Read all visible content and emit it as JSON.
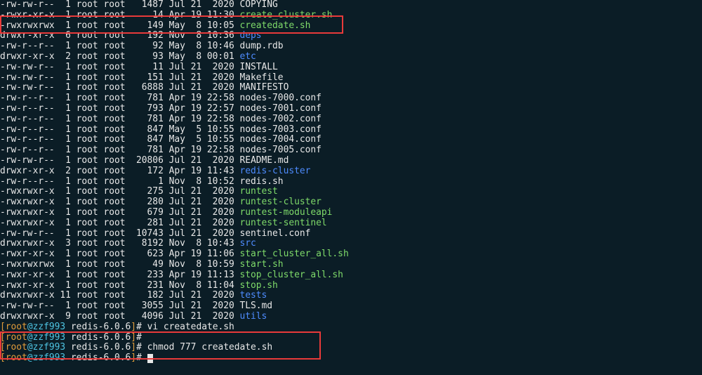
{
  "listing": [
    {
      "perm": "-rw-rw-r--",
      "links": " 1",
      "owner": "root",
      "group": "root",
      "size": "  1487",
      "date": "Jul 21  2020",
      "name": "COPYING",
      "cls": ""
    },
    {
      "perm": "-rwxr-xr-x",
      "links": " 1",
      "owner": "root",
      "group": "root",
      "size": "    14",
      "date": "Apr 19 11:30",
      "name": "create_cluster.sh",
      "cls": "green"
    },
    {
      "perm": "-rwxrwxrwx",
      "links": " 1",
      "owner": "root",
      "group": "root",
      "size": "   149",
      "date": "May  8 10:05",
      "name": "createdate.sh",
      "cls": "green"
    },
    {
      "perm": "drwxr-xr-x",
      "links": " 6",
      "owner": "root",
      "group": "root",
      "size": "   192",
      "date": "Nov  8 10:36",
      "name": "deps",
      "cls": "blue"
    },
    {
      "perm": "-rw-r--r--",
      "links": " 1",
      "owner": "root",
      "group": "root",
      "size": "    92",
      "date": "May  8 10:46",
      "name": "dump.rdb",
      "cls": ""
    },
    {
      "perm": "drwxr-xr-x",
      "links": " 2",
      "owner": "root",
      "group": "root",
      "size": "    93",
      "date": "May  8 00:01",
      "name": "etc",
      "cls": "blue"
    },
    {
      "perm": "-rw-rw-r--",
      "links": " 1",
      "owner": "root",
      "group": "root",
      "size": "    11",
      "date": "Jul 21  2020",
      "name": "INSTALL",
      "cls": ""
    },
    {
      "perm": "-rw-rw-r--",
      "links": " 1",
      "owner": "root",
      "group": "root",
      "size": "   151",
      "date": "Jul 21  2020",
      "name": "Makefile",
      "cls": ""
    },
    {
      "perm": "-rw-rw-r--",
      "links": " 1",
      "owner": "root",
      "group": "root",
      "size": "  6888",
      "date": "Jul 21  2020",
      "name": "MANIFESTO",
      "cls": ""
    },
    {
      "perm": "-rw-r--r--",
      "links": " 1",
      "owner": "root",
      "group": "root",
      "size": "   781",
      "date": "Apr 19 22:58",
      "name": "nodes-7000.conf",
      "cls": ""
    },
    {
      "perm": "-rw-r--r--",
      "links": " 1",
      "owner": "root",
      "group": "root",
      "size": "   793",
      "date": "Apr 19 22:57",
      "name": "nodes-7001.conf",
      "cls": ""
    },
    {
      "perm": "-rw-r--r--",
      "links": " 1",
      "owner": "root",
      "group": "root",
      "size": "   781",
      "date": "Apr 19 22:58",
      "name": "nodes-7002.conf",
      "cls": ""
    },
    {
      "perm": "-rw-r--r--",
      "links": " 1",
      "owner": "root",
      "group": "root",
      "size": "   847",
      "date": "May  5 10:55",
      "name": "nodes-7003.conf",
      "cls": ""
    },
    {
      "perm": "-rw-r--r--",
      "links": " 1",
      "owner": "root",
      "group": "root",
      "size": "   847",
      "date": "May  5 10:55",
      "name": "nodes-7004.conf",
      "cls": ""
    },
    {
      "perm": "-rw-r--r--",
      "links": " 1",
      "owner": "root",
      "group": "root",
      "size": "   781",
      "date": "Apr 19 22:58",
      "name": "nodes-7005.conf",
      "cls": ""
    },
    {
      "perm": "-rw-rw-r--",
      "links": " 1",
      "owner": "root",
      "group": "root",
      "size": " 20806",
      "date": "Jul 21  2020",
      "name": "README.md",
      "cls": ""
    },
    {
      "perm": "drwxr-xr-x",
      "links": " 2",
      "owner": "root",
      "group": "root",
      "size": "   172",
      "date": "Apr 19 11:43",
      "name": "redis-cluster",
      "cls": "blue"
    },
    {
      "perm": "-rw-r--r--",
      "links": " 1",
      "owner": "root",
      "group": "root",
      "size": "     1",
      "date": "Nov  8 10:52",
      "name": "redis.sh",
      "cls": ""
    },
    {
      "perm": "-rwxrwxr-x",
      "links": " 1",
      "owner": "root",
      "group": "root",
      "size": "   275",
      "date": "Jul 21  2020",
      "name": "runtest",
      "cls": "green"
    },
    {
      "perm": "-rwxrwxr-x",
      "links": " 1",
      "owner": "root",
      "group": "root",
      "size": "   280",
      "date": "Jul 21  2020",
      "name": "runtest-cluster",
      "cls": "green"
    },
    {
      "perm": "-rwxrwxr-x",
      "links": " 1",
      "owner": "root",
      "group": "root",
      "size": "   679",
      "date": "Jul 21  2020",
      "name": "runtest-moduleapi",
      "cls": "green"
    },
    {
      "perm": "-rwxrwxr-x",
      "links": " 1",
      "owner": "root",
      "group": "root",
      "size": "   281",
      "date": "Jul 21  2020",
      "name": "runtest-sentinel",
      "cls": "green"
    },
    {
      "perm": "-rw-rw-r--",
      "links": " 1",
      "owner": "root",
      "group": "root",
      "size": " 10743",
      "date": "Jul 21  2020",
      "name": "sentinel.conf",
      "cls": ""
    },
    {
      "perm": "drwxrwxr-x",
      "links": " 3",
      "owner": "root",
      "group": "root",
      "size": "  8192",
      "date": "Nov  8 10:43",
      "name": "src",
      "cls": "blue"
    },
    {
      "perm": "-rwxr-xr-x",
      "links": " 1",
      "owner": "root",
      "group": "root",
      "size": "   623",
      "date": "Apr 19 11:06",
      "name": "start_cluster_all.sh",
      "cls": "green"
    },
    {
      "perm": "-rwxrwxrwx",
      "links": " 1",
      "owner": "root",
      "group": "root",
      "size": "    49",
      "date": "Nov  8 10:59",
      "name": "start.sh",
      "cls": "green"
    },
    {
      "perm": "-rwxr-xr-x",
      "links": " 1",
      "owner": "root",
      "group": "root",
      "size": "   233",
      "date": "Apr 19 11:13",
      "name": "stop_cluster_all.sh",
      "cls": "green"
    },
    {
      "perm": "-rwxr-xr-x",
      "links": " 1",
      "owner": "root",
      "group": "root",
      "size": "   231",
      "date": "Nov  8 11:04",
      "name": "stop.sh",
      "cls": "green"
    },
    {
      "perm": "drwxrwxr-x",
      "links": "11",
      "owner": "root",
      "group": "root",
      "size": "   182",
      "date": "Jul 21  2020",
      "name": "tests",
      "cls": "blue"
    },
    {
      "perm": "-rw-rw-r--",
      "links": " 1",
      "owner": "root",
      "group": "root",
      "size": "  3055",
      "date": "Jul 21  2020",
      "name": "TLS.md",
      "cls": ""
    },
    {
      "perm": "drwxrwxr-x",
      "links": " 9",
      "owner": "root",
      "group": "root",
      "size": "  4096",
      "date": "Jul 21  2020",
      "name": "utils",
      "cls": "blue"
    }
  ],
  "prompts": [
    {
      "user": "root",
      "host": "zzf993",
      "cwd": "redis-6.0.6",
      "cmd": "vi createdate.sh"
    },
    {
      "user": "root",
      "host": "zzf993",
      "cwd": "redis-6.0.6",
      "cmd": ""
    },
    {
      "user": "root",
      "host": "zzf993",
      "cwd": "redis-6.0.6",
      "cmd": "chmod 777 createdate.sh"
    },
    {
      "user": "root",
      "host": "zzf993",
      "cwd": "redis-6.0.6",
      "cmd": ""
    }
  ]
}
